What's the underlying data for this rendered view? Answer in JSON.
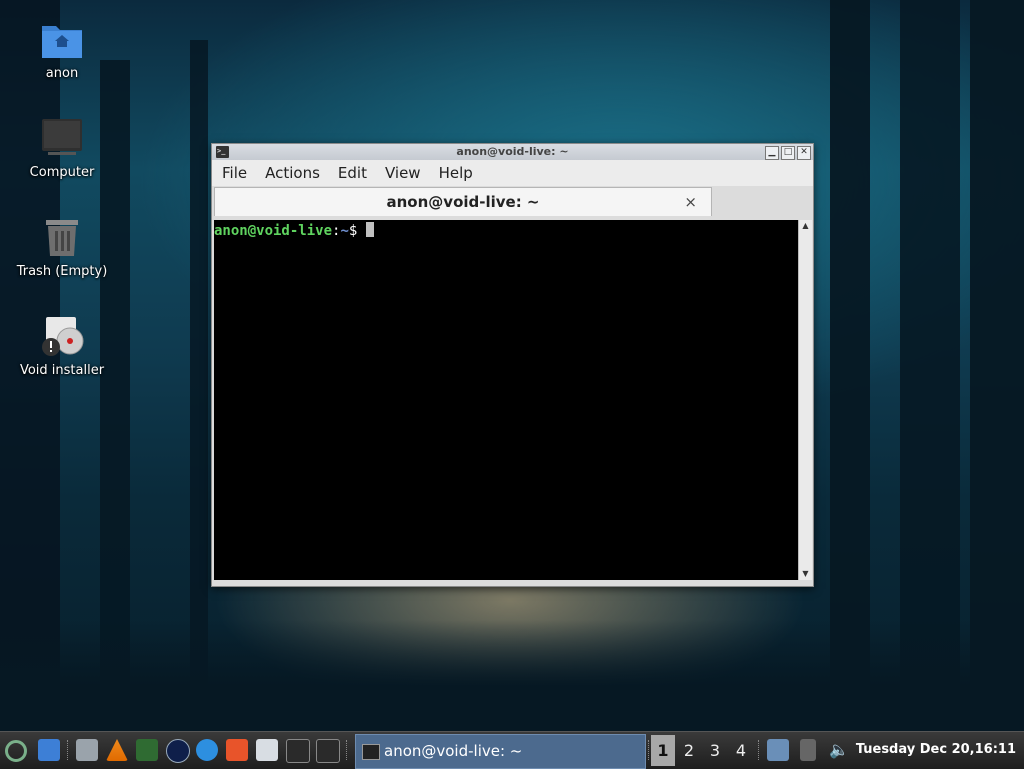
{
  "desktop": {
    "icons": [
      {
        "label": "anon",
        "icon": "home-folder-icon"
      },
      {
        "label": "Computer",
        "icon": "computer-icon"
      },
      {
        "label": "Trash (Empty)",
        "icon": "trash-icon"
      },
      {
        "label": "Void installer",
        "icon": "installer-icon"
      }
    ]
  },
  "window": {
    "title": "anon@void-live: ~",
    "controls": [
      "minimize",
      "maximize",
      "close"
    ],
    "menu": [
      "File",
      "Actions",
      "Edit",
      "View",
      "Help"
    ],
    "tab": {
      "label": "anon@void-live: ~",
      "close": "×"
    },
    "terminal": {
      "user_host": "anon@void-live",
      "sep": ":",
      "path": "~",
      "prompt": "$ "
    }
  },
  "panel": {
    "launchers": [
      "void-menu-icon",
      "show-desktop-icon",
      "file-manager-icon",
      "vlc-icon",
      "system-monitor-icon",
      "scientific-app-icon",
      "browser-icon",
      "brave-icon",
      "text-editor-icon",
      "terminal-icon",
      "terminal-icon-2"
    ],
    "task": {
      "label": "anon@void-live: ~"
    },
    "workspaces": [
      "1",
      "2",
      "3",
      "4"
    ],
    "active_workspace": "1",
    "clock": "Tuesday Dec 20,16:11"
  },
  "colors": {
    "prompt_user": "#5fd35f",
    "prompt_path": "#6f8fcf",
    "task_active": "#4c6a8e"
  }
}
